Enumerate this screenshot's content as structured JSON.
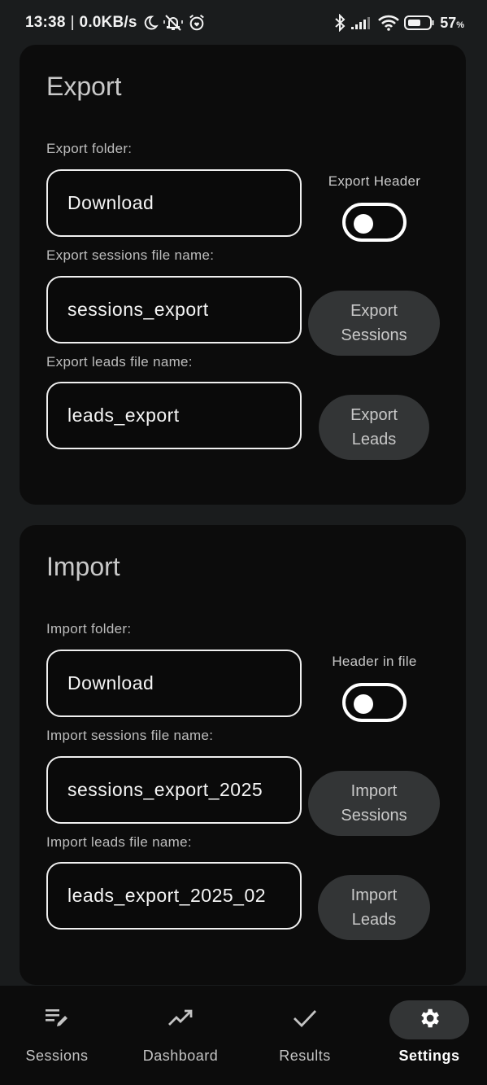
{
  "status_bar": {
    "time": "13:38",
    "separator": "|",
    "network_speed": "0.0KB/s",
    "icons_left": [
      "moon-icon",
      "bell-off-icon",
      "alarm-icon"
    ],
    "icons_right": [
      "bluetooth-icon",
      "signal-icon",
      "wifi-icon",
      "battery-icon"
    ],
    "battery_percent": "57",
    "battery_unit": "%"
  },
  "export": {
    "title": "Export",
    "folder_label": "Export folder:",
    "folder_value": "Download",
    "header_toggle_label": "Export Header",
    "header_toggle_on": false,
    "sessions_label": "Export sessions file name:",
    "sessions_value": "sessions_export",
    "sessions_button": [
      "Export",
      "Sessions"
    ],
    "leads_label": "Export leads file name:",
    "leads_value": "leads_export",
    "leads_button": [
      "Export",
      "Leads"
    ]
  },
  "import": {
    "title": "Import",
    "folder_label": "Import folder:",
    "folder_value": "Download",
    "header_toggle_label": "Header in file",
    "header_toggle_on": false,
    "sessions_label": "Import sessions file name:",
    "sessions_value": "sessions_export_2025",
    "sessions_button": [
      "Import",
      "Sessions"
    ],
    "leads_label": "Import leads file name:",
    "leads_value": "leads_export_2025_02",
    "leads_button": [
      "Import",
      "Leads"
    ]
  },
  "bottom_nav": {
    "items": [
      {
        "label": "Sessions",
        "icon": "edit-list-icon",
        "active": false
      },
      {
        "label": "Dashboard",
        "icon": "trending-up-icon",
        "active": false
      },
      {
        "label": "Results",
        "icon": "check-icon",
        "active": false
      },
      {
        "label": "Settings",
        "icon": "gear-icon",
        "active": true
      }
    ]
  },
  "colors": {
    "background": "#1a1c1d",
    "card": "#0c0c0c",
    "button": "#333536",
    "text_primary": "#f5f5f5",
    "text_secondary": "#bdbdbd"
  }
}
